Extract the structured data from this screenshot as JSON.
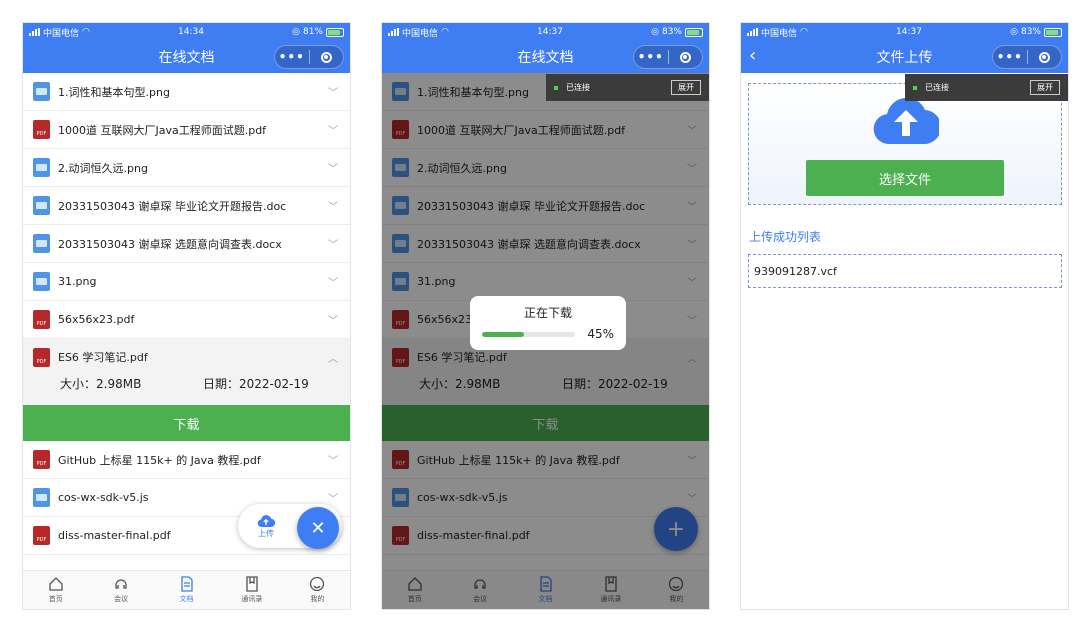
{
  "status": {
    "carrier": "中国电信",
    "screen1": {
      "time": "14:34",
      "battery": "81%"
    },
    "screen2": {
      "time": "14:37",
      "battery": "83%"
    },
    "screen3": {
      "time": "14:37",
      "battery": "83%"
    }
  },
  "titles": {
    "docs": "在线文档",
    "upload": "文件上传"
  },
  "capsule": {
    "dots": "•••"
  },
  "files": [
    {
      "name": "1.词性和基本句型.png",
      "type": "png"
    },
    {
      "name": "1000道 互联网大厂Java工程师面试题.pdf",
      "type": "pdf"
    },
    {
      "name": "2.动词恒久远.png",
      "type": "png"
    },
    {
      "name": "20331503043 谢卓琛 毕业论文开题报告.doc",
      "type": "png"
    },
    {
      "name": "20331503043 谢卓琛 选题意向调查表.docx",
      "type": "png"
    },
    {
      "name": "31.png",
      "type": "png"
    },
    {
      "name": "56x56x23.pdf",
      "type": "pdf"
    }
  ],
  "expanded_file": {
    "name": "ES6 学习笔记.pdf",
    "size_label": "大小：2.98MB",
    "date_label": "日期：2022-02-19",
    "download": "下载"
  },
  "files_after": [
    {
      "name": "GitHub 上标星 115k+ 的 Java 教程.pdf",
      "type": "pdf"
    },
    {
      "name": "cos-wx-sdk-v5.js",
      "type": "png"
    },
    {
      "name": "diss-master-final.pdf",
      "type": "pdf"
    }
  ],
  "pdf_badge": "PDF",
  "tabs": [
    "首页",
    "会议",
    "文档",
    "通讯录",
    "我的"
  ],
  "fab": {
    "upload_label": "上传",
    "close": "✕",
    "add": "+"
  },
  "connection": {
    "status": "已连接",
    "expand": "展开"
  },
  "download_toast": {
    "title": "正在下载",
    "percent": "45%",
    "progress": 0.45
  },
  "upload_page": {
    "choose_file": "选择文件",
    "success_title": "上传成功列表",
    "success_items": [
      "939091287.vcf"
    ]
  },
  "colors": {
    "primary": "#3f7df2",
    "green": "#4caf50",
    "pdf_red": "#b6282a",
    "png_blue": "#4f95e6"
  }
}
